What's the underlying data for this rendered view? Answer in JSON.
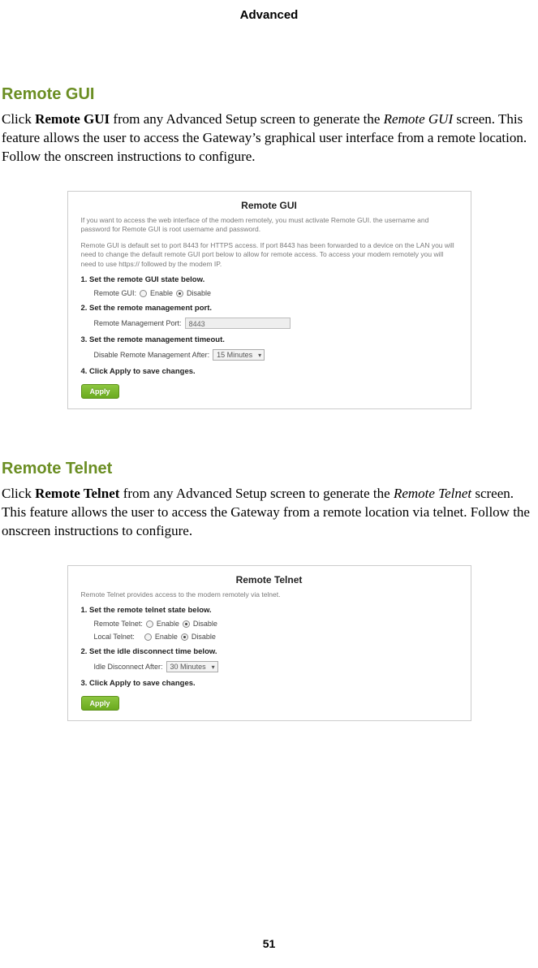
{
  "page": {
    "header": "Advanced",
    "number": "51"
  },
  "section1": {
    "heading": "Remote GUI",
    "para_prefix": "Click ",
    "para_bold": "Remote GUI",
    "para_mid": " from any Advanced Setup screen to generate the ",
    "para_italic": "Remote GUI",
    "para_suffix": " screen. This feature allows the user to access the Gateway’s graphical user interface from a remote location. Follow the onscreen instructions to configure."
  },
  "panel1": {
    "title": "Remote GUI",
    "hint1": "If you want to access the web interface of the modem remotely, you must activate Remote GUI. the username and password for Remote GUI is root username and password.",
    "hint2": "Remote GUI is default set to port 8443 for HTTPS access. If port 8443 has been forwarded to a device on the LAN you will need to change the default remote GUI port below to allow for remote access. To access your modem remotely you will need to use https:// followed by the modem IP.",
    "step1": "1. Set the remote GUI state below.",
    "row1_label": "Remote GUI:",
    "enable": "Enable",
    "disable": "Disable",
    "step2": "2. Set the remote management port.",
    "row2_label": "Remote Management Port:",
    "port_value": "8443",
    "step3": "3. Set the remote management timeout.",
    "row3_label": "Disable Remote Management After:",
    "timeout_value": "15 Minutes",
    "step4": "4. Click Apply to save changes.",
    "apply": "Apply"
  },
  "section2": {
    "heading": "Remote Telnet",
    "para_prefix": "Click ",
    "para_bold": "Remote Telnet",
    "para_mid": " from any Advanced Setup screen to generate the ",
    "para_italic": "Remote Telnet",
    "para_suffix": " screen. This feature allows the user to access the Gateway from a remote location via telnet. Follow the onscreen instructions to configure."
  },
  "panel2": {
    "title": "Remote Telnet",
    "hint1": "Remote Telnet provides access to the modem remotely via telnet.",
    "step1": "1. Set the remote telnet state below.",
    "row1_label": "Remote Telnet:",
    "row2_label": "Local Telnet:",
    "enable": "Enable",
    "disable": "Disable",
    "step2": "2. Set the idle disconnect time below.",
    "row3_label": "Idle Disconnect After:",
    "timeout_value": "30 Minutes",
    "step3": "3. Click Apply to save changes.",
    "apply": "Apply"
  }
}
